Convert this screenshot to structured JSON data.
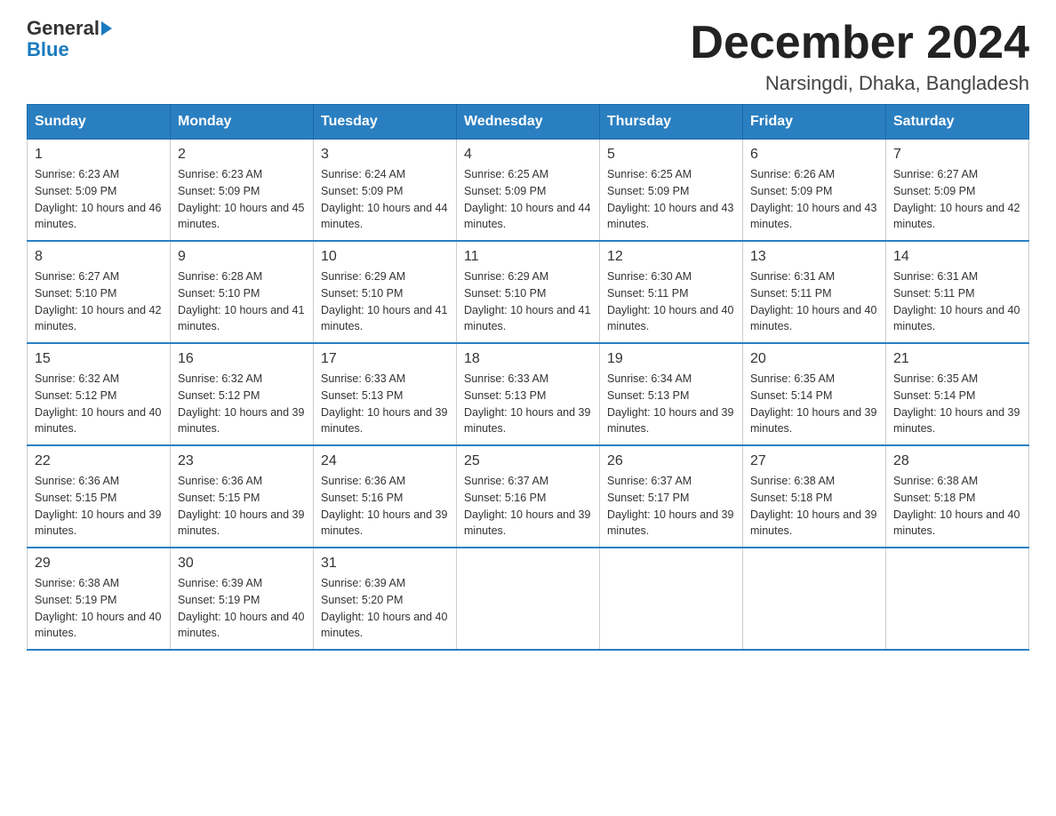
{
  "logo": {
    "text_general": "General",
    "text_blue": "Blue"
  },
  "title": {
    "month_year": "December 2024",
    "location": "Narsingdi, Dhaka, Bangladesh"
  },
  "headers": [
    "Sunday",
    "Monday",
    "Tuesday",
    "Wednesday",
    "Thursday",
    "Friday",
    "Saturday"
  ],
  "weeks": [
    [
      {
        "day": "1",
        "sunrise": "6:23 AM",
        "sunset": "5:09 PM",
        "daylight": "10 hours and 46 minutes."
      },
      {
        "day": "2",
        "sunrise": "6:23 AM",
        "sunset": "5:09 PM",
        "daylight": "10 hours and 45 minutes."
      },
      {
        "day": "3",
        "sunrise": "6:24 AM",
        "sunset": "5:09 PM",
        "daylight": "10 hours and 44 minutes."
      },
      {
        "day": "4",
        "sunrise": "6:25 AM",
        "sunset": "5:09 PM",
        "daylight": "10 hours and 44 minutes."
      },
      {
        "day": "5",
        "sunrise": "6:25 AM",
        "sunset": "5:09 PM",
        "daylight": "10 hours and 43 minutes."
      },
      {
        "day": "6",
        "sunrise": "6:26 AM",
        "sunset": "5:09 PM",
        "daylight": "10 hours and 43 minutes."
      },
      {
        "day": "7",
        "sunrise": "6:27 AM",
        "sunset": "5:09 PM",
        "daylight": "10 hours and 42 minutes."
      }
    ],
    [
      {
        "day": "8",
        "sunrise": "6:27 AM",
        "sunset": "5:10 PM",
        "daylight": "10 hours and 42 minutes."
      },
      {
        "day": "9",
        "sunrise": "6:28 AM",
        "sunset": "5:10 PM",
        "daylight": "10 hours and 41 minutes."
      },
      {
        "day": "10",
        "sunrise": "6:29 AM",
        "sunset": "5:10 PM",
        "daylight": "10 hours and 41 minutes."
      },
      {
        "day": "11",
        "sunrise": "6:29 AM",
        "sunset": "5:10 PM",
        "daylight": "10 hours and 41 minutes."
      },
      {
        "day": "12",
        "sunrise": "6:30 AM",
        "sunset": "5:11 PM",
        "daylight": "10 hours and 40 minutes."
      },
      {
        "day": "13",
        "sunrise": "6:31 AM",
        "sunset": "5:11 PM",
        "daylight": "10 hours and 40 minutes."
      },
      {
        "day": "14",
        "sunrise": "6:31 AM",
        "sunset": "5:11 PM",
        "daylight": "10 hours and 40 minutes."
      }
    ],
    [
      {
        "day": "15",
        "sunrise": "6:32 AM",
        "sunset": "5:12 PM",
        "daylight": "10 hours and 40 minutes."
      },
      {
        "day": "16",
        "sunrise": "6:32 AM",
        "sunset": "5:12 PM",
        "daylight": "10 hours and 39 minutes."
      },
      {
        "day": "17",
        "sunrise": "6:33 AM",
        "sunset": "5:13 PM",
        "daylight": "10 hours and 39 minutes."
      },
      {
        "day": "18",
        "sunrise": "6:33 AM",
        "sunset": "5:13 PM",
        "daylight": "10 hours and 39 minutes."
      },
      {
        "day": "19",
        "sunrise": "6:34 AM",
        "sunset": "5:13 PM",
        "daylight": "10 hours and 39 minutes."
      },
      {
        "day": "20",
        "sunrise": "6:35 AM",
        "sunset": "5:14 PM",
        "daylight": "10 hours and 39 minutes."
      },
      {
        "day": "21",
        "sunrise": "6:35 AM",
        "sunset": "5:14 PM",
        "daylight": "10 hours and 39 minutes."
      }
    ],
    [
      {
        "day": "22",
        "sunrise": "6:36 AM",
        "sunset": "5:15 PM",
        "daylight": "10 hours and 39 minutes."
      },
      {
        "day": "23",
        "sunrise": "6:36 AM",
        "sunset": "5:15 PM",
        "daylight": "10 hours and 39 minutes."
      },
      {
        "day": "24",
        "sunrise": "6:36 AM",
        "sunset": "5:16 PM",
        "daylight": "10 hours and 39 minutes."
      },
      {
        "day": "25",
        "sunrise": "6:37 AM",
        "sunset": "5:16 PM",
        "daylight": "10 hours and 39 minutes."
      },
      {
        "day": "26",
        "sunrise": "6:37 AM",
        "sunset": "5:17 PM",
        "daylight": "10 hours and 39 minutes."
      },
      {
        "day": "27",
        "sunrise": "6:38 AM",
        "sunset": "5:18 PM",
        "daylight": "10 hours and 39 minutes."
      },
      {
        "day": "28",
        "sunrise": "6:38 AM",
        "sunset": "5:18 PM",
        "daylight": "10 hours and 40 minutes."
      }
    ],
    [
      {
        "day": "29",
        "sunrise": "6:38 AM",
        "sunset": "5:19 PM",
        "daylight": "10 hours and 40 minutes."
      },
      {
        "day": "30",
        "sunrise": "6:39 AM",
        "sunset": "5:19 PM",
        "daylight": "10 hours and 40 minutes."
      },
      {
        "day": "31",
        "sunrise": "6:39 AM",
        "sunset": "5:20 PM",
        "daylight": "10 hours and 40 minutes."
      },
      null,
      null,
      null,
      null
    ]
  ]
}
